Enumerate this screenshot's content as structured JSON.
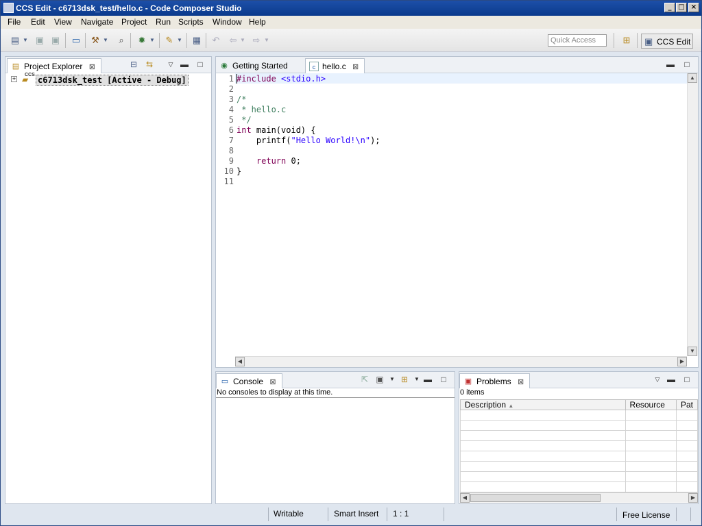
{
  "window": {
    "title": "CCS Edit - c6713dsk_test/hello.c - Code Composer Studio"
  },
  "menu": [
    "File",
    "Edit",
    "View",
    "Navigate",
    "Project",
    "Run",
    "Scripts",
    "Window",
    "Help"
  ],
  "toolbar": {
    "quick_access_placeholder": "Quick Access",
    "perspective_label": "CCS Edit"
  },
  "explorer": {
    "tab_label": "Project Explorer",
    "project_name": "c6713dsk_test",
    "project_status": "[Active - Debug]",
    "project_overlay": "CCS"
  },
  "editor": {
    "tabs": [
      {
        "label": "Getting Started",
        "icon": "globe-icon",
        "active": false
      },
      {
        "label": "hello.c",
        "icon": "c-file-icon",
        "active": true
      }
    ],
    "line_numbers": [
      "1",
      "2",
      "3",
      "4",
      "5",
      "6",
      "7",
      "8",
      "9",
      "10",
      "11"
    ],
    "code": {
      "l1_inc": "#include",
      "l1_hdr": " <stdio.h>",
      "l3": "/*",
      "l4": " * hello.c",
      "l5": " */",
      "l6_kw": "int",
      "l6_rest": " main(void) {",
      "l7_fn": "    printf(",
      "l7_str": "\"Hello World!\\n\"",
      "l7_end": ");",
      "l9_kw": "    return",
      "l9_rest": " 0;",
      "l10": "}"
    }
  },
  "console": {
    "tab_label": "Console",
    "message": "No consoles to display at this time."
  },
  "problems": {
    "tab_label": "Problems",
    "count": "0 items",
    "columns": [
      "Description",
      "Resource",
      "Pat"
    ]
  },
  "status": {
    "writable": "Writable",
    "insert_mode": "Smart Insert",
    "position": "1 : 1",
    "license": "Free License"
  },
  "colors": {
    "keyword": "#7f0055",
    "string": "#2a00ff",
    "comment": "#3f7f5f",
    "title_bar": "#0a3a8c"
  }
}
